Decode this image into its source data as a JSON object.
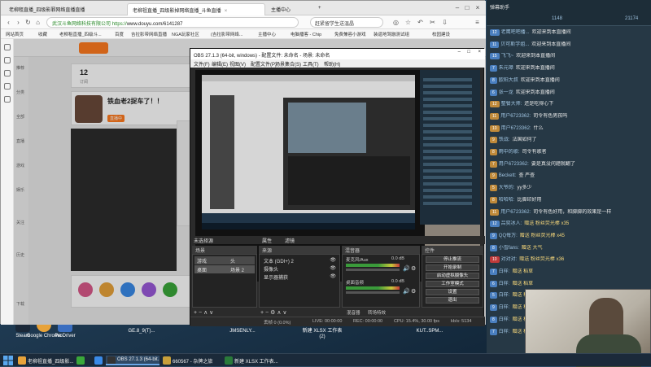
{
  "browser": {
    "tabs": [
      {
        "title": "老柳租直播_四级影罪网络直播直播",
        "active": false
      },
      {
        "title": "老柳祖直播_四级影掉网络直播_斗鱼直播",
        "active": true
      },
      {
        "title": "主播中心",
        "active": false
      }
    ],
    "new_tab": "+",
    "cert": "武汉斗鱼网络科技有限公司",
    "url_secure": "https://",
    "url": "www.douyu.com/6141287",
    "search_text": "赶紧留学生送温晶",
    "bookmarks": [
      "网站首页",
      "收藏",
      "老柳租直播_四级斗...",
      "百度",
      "吉拉影带网络直播",
      "NGA玩家社区",
      "(吉拉影带网络...",
      "主播中心",
      "电脑播客 - Chip",
      "免费兼容小游戏",
      "装逼地驾融测试组",
      "校园建设"
    ],
    "page": {
      "sub_count": "12",
      "sub_label": "订阅",
      "streamer_title": "铁血老2捉车了！！",
      "left_labels": [
        "推荐",
        "分类",
        "全部",
        "直播",
        "游戏",
        "娱乐",
        "关注",
        "历史",
        "下载"
      ],
      "badge_text": "直播中"
    }
  },
  "obs": {
    "title": "OBS 27.1.3 (64-bit, windows) - 配置文件: 未命名 - 场景: 未命名",
    "menu": [
      "文件(F)",
      "编辑(E)",
      "视图(V)",
      "配置文件(P)",
      "场景集合(S)",
      "工具(T)",
      "帮助(H)"
    ],
    "no_source": "未选择源",
    "props_btn": "属性",
    "filters_btn": "滤镜",
    "panels": {
      "scenes": "场景",
      "sources": "来源",
      "mixer": "混音器",
      "controls": "控件"
    },
    "scene_headers": [
      "场景",
      "头"
    ],
    "scenes": [
      {
        "name": "游戏",
        "tag": "头"
      },
      {
        "name": "桌面",
        "tag": "场景 2",
        "selected": true
      }
    ],
    "sources": [
      "文本 (GDI+) 2",
      "摄像头",
      "显示器捕获"
    ],
    "mixer": [
      {
        "name": "麦克风/Aux",
        "db": "0.0 dB"
      },
      {
        "name": "桌面音频",
        "db": "0.0 dB"
      }
    ],
    "controls": [
      "停止推流",
      "开始录制",
      "启动虚拟摄像头",
      "工作室模式",
      "设置",
      "退出"
    ],
    "transition_tabs": [
      "混音器",
      "转场特效"
    ],
    "status": {
      "dropped": "丢帧 0 (0.0%)",
      "live": "LIVE: 00:00:00",
      "rec": "REC: 00:00:00",
      "cpu": "CPU: 15.4%, 30.00 fps",
      "bitrate": "kb/s: 5134"
    }
  },
  "chat": {
    "header": {
      "title": "弹幕助手",
      "stats": [
        "1148",
        "21174"
      ]
    },
    "messages": [
      {
        "badge": "12",
        "color": "#4a7fc0",
        "nick": "老鹰吧吧播...",
        "text": "欢迎来到本直播间"
      },
      {
        "badge": "11",
        "color": "#4a7fc0",
        "nick": "贝可斯学姐...",
        "text": "欢迎来到本直播间"
      },
      {
        "badge": "15",
        "color": "#4a7fc0",
        "nick": "飞飞~",
        "text": "欢迎来到本直播间"
      },
      {
        "badge": "7",
        "color": "#4a7fc0",
        "nick": "朱元璋",
        "text": "欢迎来到本直播间"
      },
      {
        "badge": "8",
        "color": "#4a7fc0",
        "nick": "欧阳大叔",
        "text": "欢迎来到本直播间"
      },
      {
        "badge": "6",
        "color": "#4a7fc0",
        "nick": "张一龙",
        "text": "欢迎来到本直播间"
      },
      {
        "badge": "12",
        "color": "#c08a3a",
        "nick": "整餐大师:",
        "text": "还是吃得心下"
      },
      {
        "badge": "11",
        "color": "#c08a3a",
        "nick": "用户6723362:",
        "text": "司令有色男孩吗"
      },
      {
        "badge": "10",
        "color": "#c08a3a",
        "nick": "用户6723362:",
        "text": "什么"
      },
      {
        "badge": "9",
        "color": "#c08a3a",
        "nick": "铁战:",
        "text": "法国如何了"
      },
      {
        "badge": "8",
        "color": "#c08a3a",
        "nick": "雨中的歌:",
        "text": "司令有歌者"
      },
      {
        "badge": "7",
        "color": "#c08a3a",
        "nick": "用户6723362:",
        "text": "要是真没问题就翻了"
      },
      {
        "badge": "9",
        "color": "#c08a3a",
        "nick": "Beckett:",
        "text": "查 严查"
      },
      {
        "badge": "5",
        "color": "#c08a3a",
        "nick": "大爷的:",
        "text": "yy多少"
      },
      {
        "badge": "8",
        "color": "#c08a3a",
        "nick": "哈哈哈:",
        "text": "比脚印好用"
      },
      {
        "badge": "11",
        "color": "#c08a3a",
        "nick": "用户6723362:",
        "text": "司令有色好用，和脚脚的效果是一样"
      },
      {
        "badge": "12",
        "color": "#4a7fc0",
        "nick": "吕奕冰人:",
        "text": "赠送 粉丝荧光棒 x35",
        "gift": true
      },
      {
        "badge": "9",
        "color": "#4a7fc0",
        "nick": "QQ每万:",
        "text": "赠送 粉丝荧光棒 x45",
        "gift": true
      },
      {
        "badge": "8",
        "color": "#4a7fc0",
        "nick": "小雪fans:",
        "text": "赠送 大气",
        "gift": true
      },
      {
        "badge": "10",
        "color": "#c03a3a",
        "nick": "对对对:",
        "text": "赠送 粉丝荧光棒 x36",
        "gift": true
      },
      {
        "badge": "7",
        "color": "#4a7fc0",
        "nick": "白样:",
        "text": "赠送 稻草",
        "gift": true
      },
      {
        "badge": "6",
        "color": "#4a7fc0",
        "nick": "白样:",
        "text": "赠送 稻草",
        "gift": true
      },
      {
        "badge": "5",
        "color": "#4a7fc0",
        "nick": "白样:",
        "text": "赠送 稻草",
        "gift": true
      },
      {
        "badge": "9",
        "color": "#4a7fc0",
        "nick": "白样:",
        "text": "赠送 稻草",
        "gift": true
      },
      {
        "badge": "8",
        "color": "#4a7fc0",
        "nick": "白样:",
        "text": "赠送 稻草",
        "gift": true
      },
      {
        "badge": "7",
        "color": "#4a7fc0",
        "nick": "白样:",
        "text": "赠送 稻草",
        "gift": true
      }
    ]
  },
  "desktop_icons": [
    {
      "label": "Steam",
      "color": "#1b2838"
    },
    {
      "label": "Google Chrome",
      "color": "#e8a33a"
    },
    {
      "label": "ProDriver",
      "color": "#3a6ec0"
    },
    {
      "label": "GE.8_9(T)...",
      "color": "#5a5a5a"
    },
    {
      "label": "JMSENLY...",
      "color": "#5a5a5a"
    },
    {
      "label": "新建 XLSX 工作表 (2)",
      "color": "#2a7a3a"
    },
    {
      "label": "KUT..SPM...",
      "color": "#5a5a5a"
    }
  ],
  "taskbar": {
    "items": [
      {
        "label": "老柳祖直播_四级影...",
        "color": "#e8a33a",
        "active": false
      },
      {
        "label": "",
        "color": "#3aa83a",
        "active": false
      },
      {
        "label": "",
        "color": "#3a8ae8",
        "active": false
      },
      {
        "label": "OBS 27.1.3 (64-bit...",
        "color": "#333",
        "active": true
      },
      {
        "label": "660567 - 杂牌之旅",
        "color": "#c8a03a",
        "active": false
      },
      {
        "label": "新建 XLSX 工作表...",
        "color": "#2a7a3a",
        "active": false
      }
    ]
  }
}
